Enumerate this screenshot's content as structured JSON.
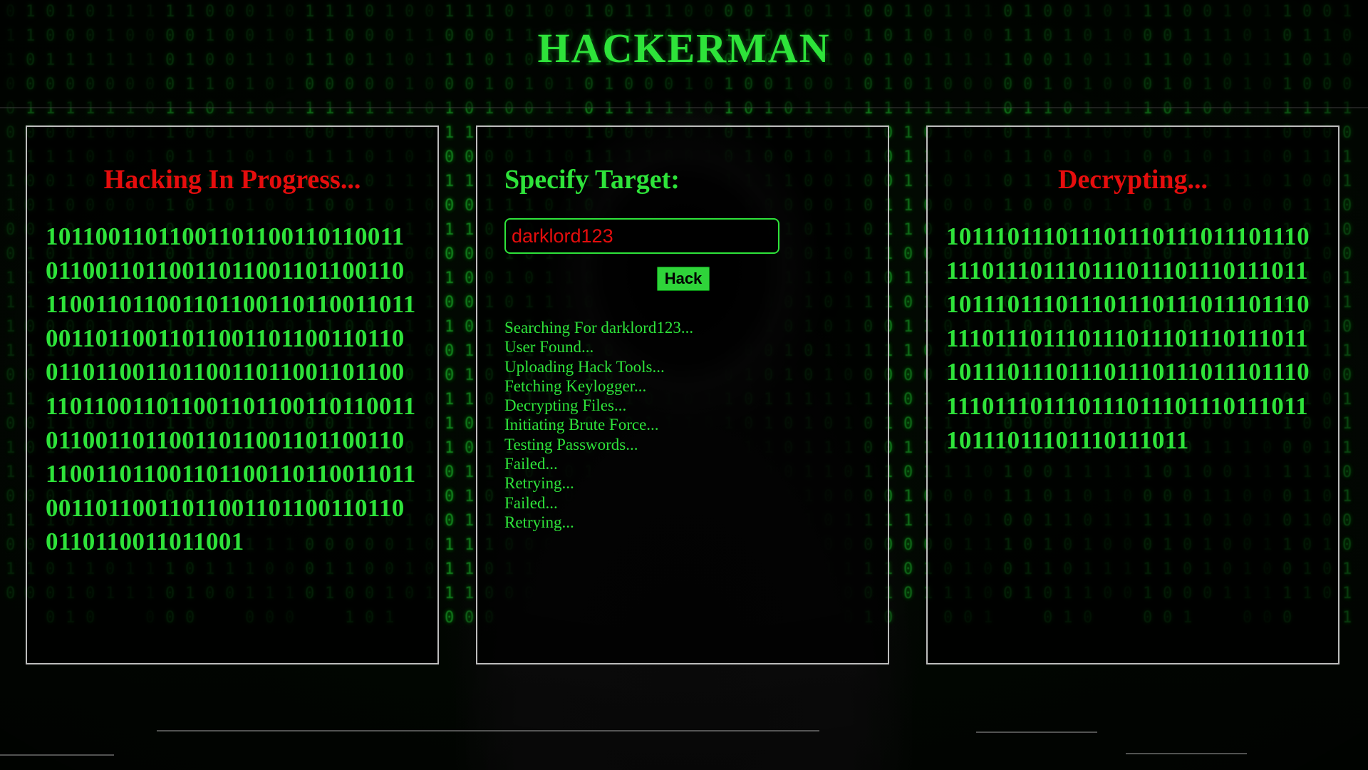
{
  "header": {
    "title": "HACKERMAN"
  },
  "left_panel": {
    "title": "Hacking In Progress...",
    "binary": "1011001101100110110011011001101100110110011011001101100110110011011001101100110110011011001101100110110011011001101100110110011011001101100110110011011001101100110110011011001101100110110011011001101100110110011011001101100110110011011001101100110110011011001101100110110011011001"
  },
  "center_panel": {
    "title": "Specify Target:",
    "target_value": "darklord123",
    "hack_label": "Hack",
    "log": [
      "Searching For darklord123...",
      "User Found...",
      "Uploading Hack Tools...",
      "Fetching Keylogger...",
      "Decrypting Files...",
      "Initiating Brute Force...",
      "Testing Passwords...",
      "Failed...",
      "Retrying...",
      "Failed...",
      "Retrying..."
    ]
  },
  "right_panel": {
    "title": "Decrypting...",
    "binary": "10111011101110111011101110111011101110111011101110111011101110111011101110111011101110111011101110111011101110111011101110111011101110111011101110111011101110111011101110111011101110111011101110111011"
  },
  "colors": {
    "accent_green": "#2ee33a",
    "alert_red": "#e50d0d",
    "panel_border": "#bdbdbd",
    "background": "#000000"
  },
  "background": {
    "rain_glyphs": "1011 0100 1101 0010 1110 0101 1001 0110 1010 0011 1100 0111"
  }
}
